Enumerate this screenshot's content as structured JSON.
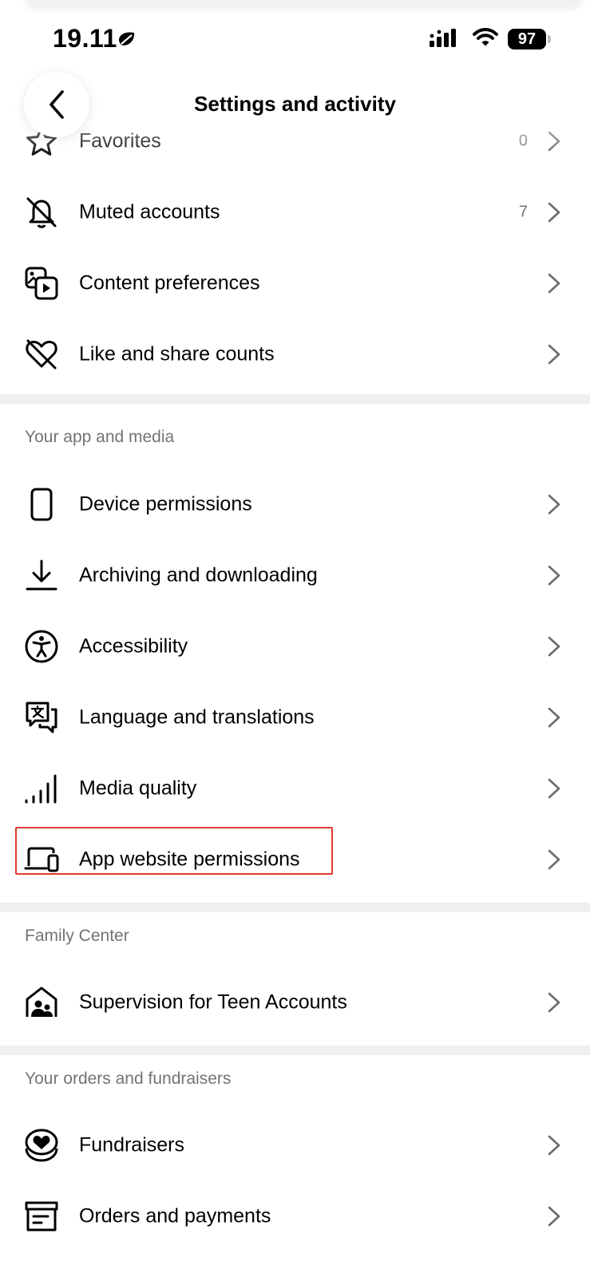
{
  "status_bar": {
    "time": "19.11",
    "battery": "97"
  },
  "header": {
    "title": "Settings and activity",
    "back_label": "Back"
  },
  "sections": [
    {
      "header": "",
      "items": [
        {
          "label": "Favorites",
          "count": "0",
          "icon": "star-icon"
        },
        {
          "label": "Muted accounts",
          "count": "7",
          "icon": "muted-bell-icon"
        },
        {
          "label": "Content preferences",
          "count": "",
          "icon": "content-media-icon"
        },
        {
          "label": "Like and share counts",
          "count": "",
          "icon": "heart-off-icon"
        }
      ]
    },
    {
      "header": "Your app and media",
      "items": [
        {
          "label": "Device permissions",
          "icon": "phone-icon"
        },
        {
          "label": "Archiving and downloading",
          "icon": "download-icon"
        },
        {
          "label": "Accessibility",
          "icon": "accessibility-icon"
        },
        {
          "label": "Language and translations",
          "icon": "translate-icon"
        },
        {
          "label": "Media quality",
          "icon": "signal-bars-icon"
        },
        {
          "label": "App website permissions",
          "icon": "devices-icon",
          "highlighted": true
        }
      ]
    },
    {
      "header": "Family Center",
      "items": [
        {
          "label": "Supervision for Teen Accounts",
          "icon": "family-home-icon"
        }
      ]
    },
    {
      "header": "Your orders and fundraisers",
      "items": [
        {
          "label": "Fundraisers",
          "icon": "fundraiser-heart-icon"
        },
        {
          "label": "Orders and payments",
          "icon": "orders-box-icon"
        }
      ]
    }
  ],
  "colors": {
    "highlight": "#e03a2f",
    "secondary_text": "#737373",
    "divider": "#efeff2"
  }
}
